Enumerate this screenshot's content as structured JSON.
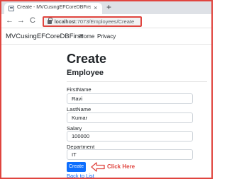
{
  "browser": {
    "tab_title": "Create - MVCusingEFCoreDBFirst",
    "tab_close": "×",
    "new_tab": "+",
    "back": "←",
    "forward": "→",
    "reload": "C",
    "url_host": "localhost",
    "url_path": ":7073/Employees/Create"
  },
  "navbar": {
    "brand": "MVCusingEFCoreDBFirst",
    "links": [
      "Home",
      "Privacy"
    ]
  },
  "page": {
    "title": "Create",
    "subtitle": "Employee"
  },
  "form": {
    "fields": [
      {
        "label": "FirstName",
        "value": "Ravi"
      },
      {
        "label": "LastName",
        "value": "Kumar"
      },
      {
        "label": "Salary",
        "value": "100000"
      },
      {
        "label": "Department",
        "value": "IT"
      }
    ],
    "submit_label": "Create",
    "back_link": "Back to List"
  },
  "annotation": {
    "text": "Click Here",
    "color": "#e0453f"
  },
  "colors": {
    "primary": "#0d6efd",
    "highlight": "#e0453f"
  }
}
